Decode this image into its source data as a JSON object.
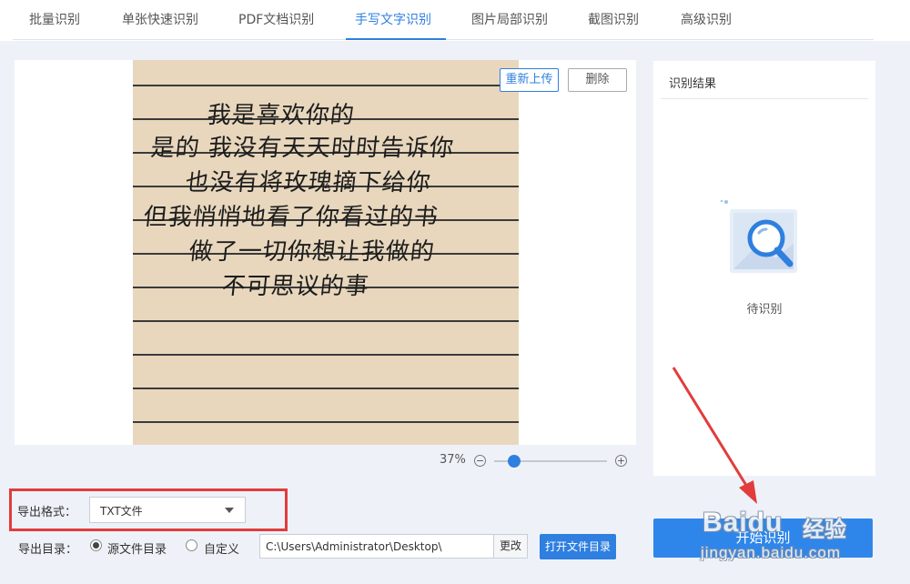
{
  "tabs": [
    {
      "label": "批量识别",
      "active": false
    },
    {
      "label": "单张快速识别",
      "active": false
    },
    {
      "label": "PDF文档识别",
      "active": false
    },
    {
      "label": "手写文字识别",
      "active": true
    },
    {
      "label": "图片局部识别",
      "active": false
    },
    {
      "label": "截图识别",
      "active": false
    },
    {
      "label": "高级识别",
      "active": false
    }
  ],
  "preview": {
    "reupload_label": "重新上传",
    "delete_label": "删除",
    "handwriting_lines": [
      "我是喜欢你的",
      "是的   我没有天天时时告诉你",
      "也没有将玫瑰摘下给你",
      "但我悄悄地看了你看过的书",
      "做了一切你想让我做的",
      "不可思议的事"
    ],
    "zoom_percent": "37%",
    "zoom_level": 0.18
  },
  "result": {
    "title": "识别结果",
    "status": "待识别",
    "icon": "search-document-icon"
  },
  "export": {
    "format_label": "导出格式：",
    "format_value": "TXT文件",
    "dir_label": "导出目录：",
    "radio_source": "源文件目录",
    "radio_custom": "自定义",
    "selected_radio": "source",
    "path_value": "C:\\Users\\Administrator\\Desktop\\",
    "change_label": "更改",
    "open_dir_label": "打开文件目录"
  },
  "start_label": "开始识别",
  "watermark": {
    "brand": "Baidu",
    "cn": "经验",
    "url": "jingyan.baidu.com"
  },
  "colors": {
    "accent": "#2f7fe0",
    "highlight_box": "#e23c3c"
  }
}
